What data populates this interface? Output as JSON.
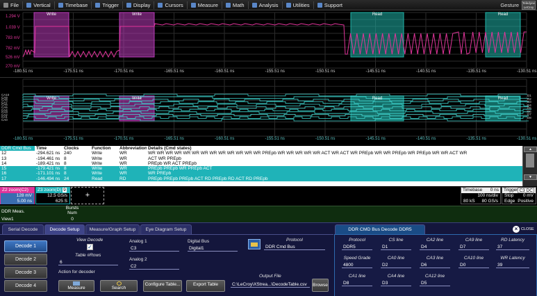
{
  "menu": [
    {
      "label": "File",
      "icon": "file-icon"
    },
    {
      "label": "Vertical",
      "icon": "vertical-icon"
    },
    {
      "label": "Timebase",
      "icon": "timebase-icon"
    },
    {
      "label": "Trigger",
      "icon": "trigger-icon"
    },
    {
      "label": "Display",
      "icon": "display-icon"
    },
    {
      "label": "Cursors",
      "icon": "cursors-icon"
    },
    {
      "label": "Measure",
      "icon": "measure-icon"
    },
    {
      "label": "Math",
      "icon": "math-icon"
    },
    {
      "label": "Analysis",
      "icon": "analysis-icon"
    },
    {
      "label": "Utilities",
      "icon": "utilities-icon"
    },
    {
      "label": "Support",
      "icon": "support-icon"
    }
  ],
  "gesture": "Gesture",
  "logo": "Teledyne LeCroy",
  "top_grid": {
    "y_ticks": [
      "1.294 V",
      "1.039 V",
      "783 mV",
      "782 mV",
      "526 mV",
      "270 mV"
    ],
    "x_ticks": [
      "-180.51 ns",
      "-175.51 ns",
      "-170.51 ns",
      "-165.51 ns",
      "-160.51 ns",
      "-155.51 ns",
      "-150.51 ns",
      "-145.51 ns",
      "-140.51 ns",
      "-135.51 ns",
      "-130.51 ns"
    ],
    "zones": [
      {
        "label": "Write",
        "color": "#b93bb9"
      },
      {
        "label": "Write",
        "color": "#b93bb9"
      },
      {
        "label": "Read",
        "color": "#1fb3a8"
      },
      {
        "label": "Read",
        "color": "#1fb3a8"
      }
    ]
  },
  "bottom_grid": {
    "left_labels": [
      "CA10",
      "CA9",
      "CA8",
      "CA7",
      "CA6",
      "CA5",
      "CA4",
      "CA3",
      "CA2",
      "CA1",
      "CA0"
    ],
    "right_labels": [
      "D1",
      "D2",
      "D3",
      "D4",
      "D5",
      "D6",
      "D7",
      "D8"
    ],
    "x_ticks": [
      "-180.51 ns",
      "-175.51 ns",
      "-170.51 ns",
      "-165.51 ns",
      "-160.51 ns",
      "-155.51 ns",
      "-150.51 ns",
      "-145.51 ns",
      "-140.51 ns",
      "-135.51 ns",
      "-130.51 ns"
    ],
    "zones": [
      {
        "label": "Write",
        "color": "#b93bb9"
      },
      {
        "label": "Write",
        "color": "#b93bb9"
      },
      {
        "label": "Read",
        "color": "#1fb3a8"
      },
      {
        "label": "Read",
        "color": "#1fb3a8"
      }
    ]
  },
  "table": {
    "headers": [
      "DDR Cmd Bus",
      "Time",
      "Clocks",
      "Function",
      "Abbreviation",
      "Details (Cmd states)"
    ],
    "rows": [
      {
        "idx": "12",
        "time": "-294.621 ns",
        "clocks": "240",
        "function": "Write",
        "abbr": "WR",
        "details": "WR WR WR WR WR WR WR WR WR WR WR WR WR PREpb WR WR WR WR WR ACT WR ACT WR PREpb WR WR PREpb WR PREpb WR WR ACT WR",
        "hi": false
      },
      {
        "idx": "13",
        "time": "-194.461 ns",
        "clocks": "8",
        "function": "Write",
        "abbr": "WR",
        "details": "ACT WR PREpb",
        "hi": false
      },
      {
        "idx": "14",
        "time": "-189.421 ns",
        "clocks": "8",
        "function": "Write",
        "abbr": "WR",
        "details": "PREpb WR ACT PREpb",
        "hi": false
      },
      {
        "idx": "15",
        "time": "-179.421 ns",
        "clocks": "8",
        "function": "Write",
        "abbr": "WR",
        "details": "PREpb PREpb WR PREpb ACT",
        "hi": true
      },
      {
        "idx": "16",
        "time": "-171.101 ns",
        "clocks": "8",
        "function": "Write",
        "abbr": "WR",
        "details": "WR PREpb",
        "hi": true
      },
      {
        "idx": "17",
        "time": "-146.494 ns",
        "clocks": "24",
        "function": "Read",
        "abbr": "RD",
        "details": "PREpb PREpb PREpb ACT RD PREpb RD ACT RD PREpb",
        "hi": true
      }
    ]
  },
  "desc": {
    "z2": {
      "title": "Z2",
      "sub": "zoom(C2)",
      "lines": [
        "128 mV",
        "5.00 ns"
      ]
    },
    "z3": {
      "title": "Z3",
      "sub": "zoom(D)",
      "badge": "9",
      "lines": [
        "12.5 GS/s",
        "625 S"
      ]
    },
    "add_symbol": "+",
    "timebase": {
      "title": "Timebase",
      "value": "0 ns",
      "lines": [
        "100 ns/div",
        "80 kS",
        "80 GS/s"
      ]
    },
    "trigger": {
      "title": "Trigger",
      "badge": "C3 DC",
      "lines": [
        "Stop",
        "0 mV",
        "Edge",
        "Positive"
      ]
    }
  },
  "meas": {
    "label": "DDR Meas.",
    "col_lines": [
      "Bursts",
      "Num"
    ],
    "view": "View1",
    "value": "0"
  },
  "dialog": {
    "tabs": [
      "Serial Decode",
      "Decode Setup",
      "Measure/Graph Setup",
      "Eye Diagram Setup"
    ],
    "right_tab": "DDR CMD Bus Decode DDR5",
    "close": "CLOSE",
    "decoders": [
      "Decode 1",
      "Decode 2",
      "Decode 3",
      "Decode 4"
    ],
    "view_decode": "View Decode",
    "table_rows_label": "Table #Rows",
    "table_rows": "6",
    "analog1_label": "Analog 1",
    "analog1": "C3",
    "analog2_label": "Analog 2",
    "analog2": "C2",
    "digital_bus_label": "Digital Bus",
    "digital_bus": "Digital1",
    "protocol_label": "Protocol",
    "protocol": "DDR Cmd Bus",
    "action_label": "Action for decoder",
    "buttons": [
      "Measure",
      "Search",
      "Configure Table...",
      "Export Table"
    ],
    "output_label": "Output File",
    "output_file": "C:\\LeCroy\\XStrea...\\DecodeTable.csv",
    "browse": "Browse"
  },
  "right_panel": [
    {
      "label": "Protocol",
      "value": "DDR5"
    },
    {
      "label": "CS line",
      "value": "D1"
    },
    {
      "label": "CA2 line",
      "value": "D4"
    },
    {
      "label": "CA9 line",
      "value": "D7"
    },
    {
      "label": "RD Latency",
      "value": "37"
    },
    {
      "label": "Speed Grade",
      "value": "4800"
    },
    {
      "label": "CA0 line",
      "value": "D2"
    },
    {
      "label": "CA3 line",
      "value": "D6"
    },
    {
      "label": "CA10 line",
      "value": "D0"
    },
    {
      "label": "WR Latency",
      "value": "39"
    },
    {
      "label": "CA1 line",
      "value": "D8"
    },
    {
      "label": "CA4 line",
      "value": "D3"
    },
    {
      "label": "CA12 line",
      "value": "D5"
    }
  ]
}
